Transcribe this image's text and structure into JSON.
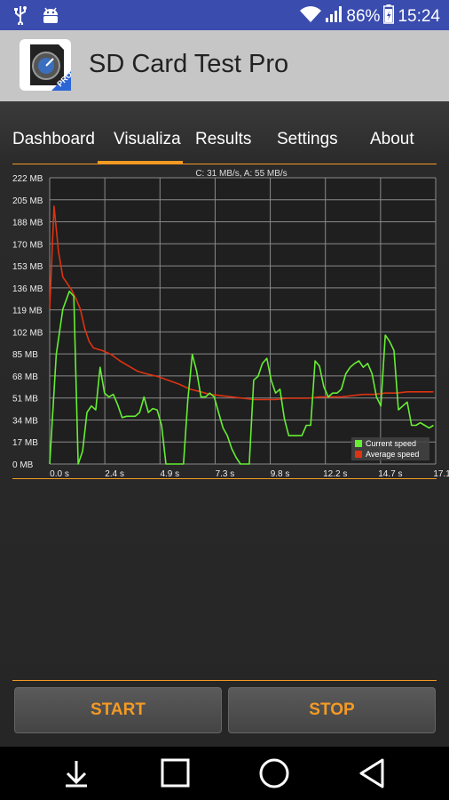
{
  "status_bar": {
    "battery_percent": "86%",
    "time": "15:24",
    "icons": [
      "usb-icon",
      "android-debug-icon",
      "wifi-icon",
      "signal-icon",
      "battery-icon"
    ]
  },
  "app": {
    "title": "SD Card Test Pro",
    "icon_badge": "PRO"
  },
  "tabs": [
    {
      "label": "Dashboard",
      "selected": false
    },
    {
      "label": "Visualiza",
      "selected": true
    },
    {
      "label": "Results",
      "selected": false
    },
    {
      "label": "Settings",
      "selected": false
    },
    {
      "label": "About",
      "selected": false
    }
  ],
  "chart_data": {
    "type": "line",
    "title": "C: 31 MB/s, A: 55 MB/s",
    "xlabel": "",
    "ylabel": "",
    "y_ticks": [
      "0 MB",
      "17 MB",
      "34 MB",
      "51 MB",
      "68 MB",
      "85 MB",
      "102 MB",
      "119 MB",
      "136 MB",
      "153 MB",
      "170 MB",
      "188 MB",
      "205 MB",
      "222 MB"
    ],
    "x_ticks": [
      "0.0 s",
      "2.4 s",
      "4.9 s",
      "7.3 s",
      "9.8 s",
      "12.2 s",
      "14.7 s",
      "17.1 s"
    ],
    "ylim": [
      0,
      222
    ],
    "xlim": [
      0,
      17.6
    ],
    "grid": true,
    "legend_position": "bottom-right",
    "series": [
      {
        "name": "Current speed",
        "color": "#66ee33",
        "x": [
          0,
          0.3,
          0.6,
          0.9,
          1.1,
          1.3,
          1.5,
          1.7,
          1.9,
          2.1,
          2.3,
          2.5,
          2.7,
          2.9,
          3.1,
          3.3,
          3.5,
          3.7,
          3.9,
          4.1,
          4.3,
          4.5,
          4.7,
          4.9,
          5.1,
          5.3,
          5.5,
          5.7,
          5.9,
          6.1,
          6.3,
          6.5,
          6.7,
          6.9,
          7.1,
          7.3,
          7.5,
          7.7,
          7.9,
          8.1,
          8.3,
          8.5,
          8.7,
          8.9,
          9.1,
          9.3,
          9.5,
          9.7,
          9.9,
          10.1,
          10.3,
          10.5,
          10.7,
          10.9,
          11.1,
          11.3,
          11.5,
          11.7,
          11.9,
          12.1,
          12.3,
          12.5,
          12.7,
          12.9,
          13.1,
          13.3,
          13.5,
          13.7,
          13.9,
          14.1,
          14.3,
          14.5,
          14.7,
          14.9,
          15.1,
          15.3,
          15.5,
          15.7,
          15.9,
          16.1,
          16.3,
          16.5,
          16.7,
          16.9,
          17.1,
          17.3,
          17.5
        ],
        "values": [
          0,
          85,
          120,
          134,
          130,
          0,
          10,
          40,
          45,
          42,
          75,
          55,
          52,
          54,
          46,
          36,
          37,
          37,
          37,
          40,
          52,
          40,
          43,
          42,
          30,
          0,
          0,
          0,
          0,
          0,
          50,
          85,
          72,
          52,
          52,
          55,
          52,
          40,
          28,
          22,
          12,
          5,
          0,
          0,
          0,
          65,
          68,
          78,
          82,
          65,
          55,
          58,
          35,
          22,
          22,
          22,
          22,
          30,
          30,
          80,
          76,
          60,
          52,
          55,
          55,
          58,
          70,
          75,
          78,
          80,
          75,
          78,
          70,
          52,
          45,
          100,
          95,
          88,
          42,
          45,
          48,
          30,
          30,
          32,
          30,
          28,
          30
        ]
      },
      {
        "name": "Average speed",
        "color": "#dd3311",
        "x": [
          0,
          0.2,
          0.4,
          0.6,
          0.8,
          1.0,
          1.2,
          1.4,
          1.6,
          1.8,
          2.0,
          2.4,
          2.8,
          3.2,
          3.6,
          4.0,
          4.4,
          4.9,
          5.4,
          5.9,
          6.4,
          6.9,
          7.3,
          7.8,
          8.3,
          8.8,
          9.3,
          9.8,
          10.3,
          10.8,
          11.3,
          11.8,
          12.3,
          12.8,
          13.3,
          13.8,
          14.3,
          14.8,
          15.3,
          15.8,
          16.3,
          16.8,
          17.3,
          17.5
        ],
        "values": [
          120,
          200,
          165,
          145,
          140,
          135,
          128,
          120,
          105,
          95,
          90,
          88,
          85,
          80,
          76,
          72,
          70,
          68,
          65,
          62,
          58,
          56,
          54,
          53,
          52,
          51,
          50,
          50,
          50,
          51,
          51,
          51,
          52,
          52,
          52,
          53,
          54,
          54,
          55,
          55,
          56,
          56,
          56,
          56
        ]
      }
    ]
  },
  "buttons": {
    "start": "START",
    "stop": "STOP"
  },
  "nav": {
    "icons": [
      "download-icon",
      "recents-square-icon",
      "home-circle-icon",
      "back-triangle-icon"
    ]
  }
}
